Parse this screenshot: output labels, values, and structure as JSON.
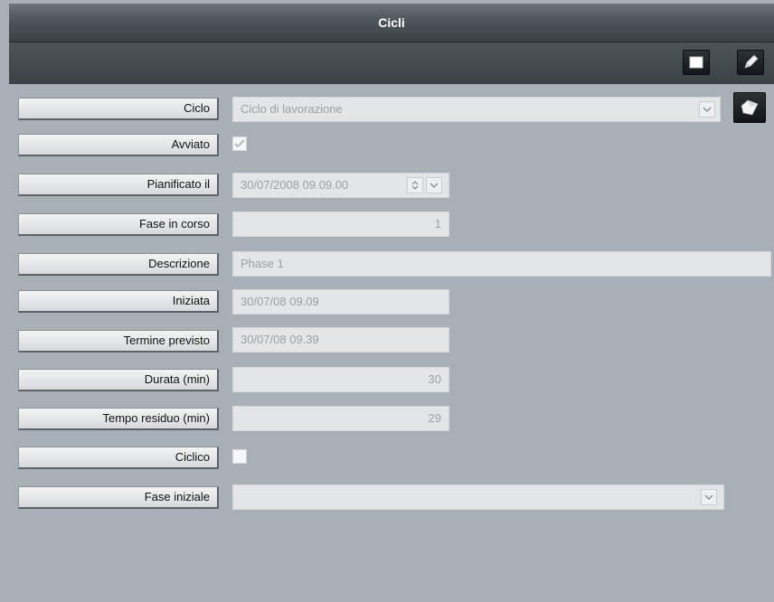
{
  "window": {
    "title": "Cicli"
  },
  "toolbar": {
    "stop_icon": "square-stop-icon",
    "edit_icon": "pencil-icon"
  },
  "form": {
    "ciclo": {
      "label": "Ciclo",
      "value": "Ciclo di lavorazione"
    },
    "avviato": {
      "label": "Avviato",
      "checked": true
    },
    "pianificato": {
      "label": "Pianificato il",
      "value": "30/07/2008 09.09.00"
    },
    "fase_in_corso": {
      "label": "Fase in corso",
      "value": "1"
    },
    "descrizione": {
      "label": "Descrizione",
      "value": "Phase 1"
    },
    "iniziata": {
      "label": "Iniziata",
      "value": "30/07/08 09.09"
    },
    "termine_previsto": {
      "label": "Termine previsto",
      "value": "30/07/08 09.39"
    },
    "durata": {
      "label": "Durata (min)",
      "value": "30"
    },
    "tempo_residuo": {
      "label": "Tempo residuo (min)",
      "value": "29"
    },
    "ciclico": {
      "label": "Ciclico",
      "checked": false
    },
    "fase_iniziale": {
      "label": "Fase iniziale",
      "value": ""
    }
  },
  "side_button_icon": "open-folder-icon"
}
